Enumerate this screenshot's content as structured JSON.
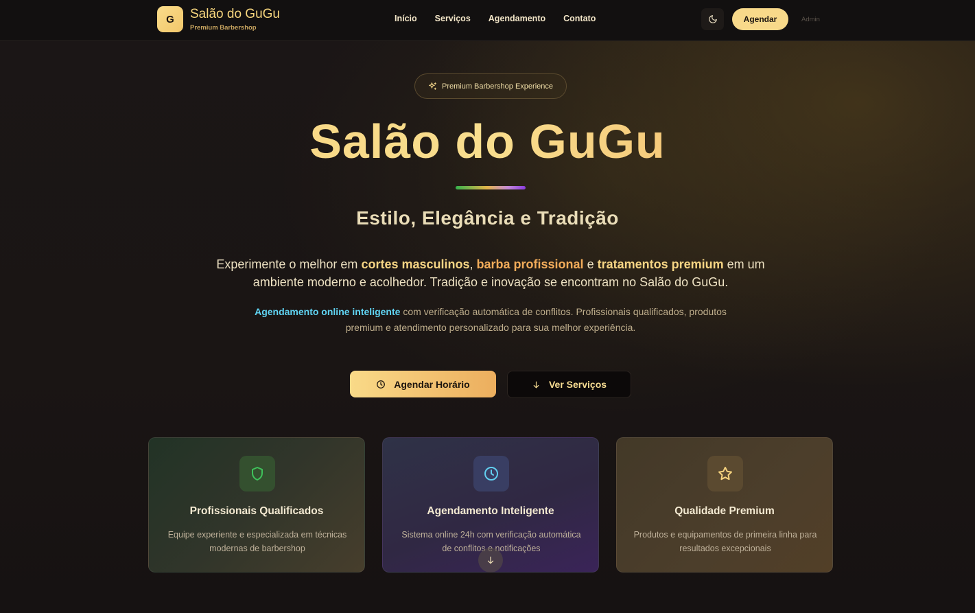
{
  "header": {
    "logo_letter": "G",
    "brand_title": "Salão do GuGu",
    "brand_subtitle": "Premium Barbershop",
    "nav": [
      "Início",
      "Serviços",
      "Agendamento",
      "Contato"
    ],
    "theme_icon": "moon-icon",
    "cta_label": "Agendar",
    "admin_label": "Admin"
  },
  "hero": {
    "badge": "Premium Barbershop Experience",
    "title": "Salão do GuGu",
    "subtitle": "Estilo, Elegância e Tradição",
    "desc_1": "Experimente o melhor em ",
    "desc_hl_1": "cortes masculinos",
    "desc_2": ", ",
    "desc_hl_2": "barba profissional",
    "desc_3": " e ",
    "desc_hl_3": "tratamentos premium",
    "desc_4": " em um ambiente moderno e acolhedor. Tradição e inovação se encontram no Salão do GuGu.",
    "note_hl": "Agendamento online inteligente",
    "note_rest": " com verificação automática de conflitos. Profissionais qualificados, produtos premium e atendimento personalizado para sua melhor experiência.",
    "primary_button": "Agendar Horário",
    "secondary_button": "Ver Serviços"
  },
  "features": [
    {
      "icon": "shield-icon",
      "title": "Profissionais Qualificados",
      "text": "Equipe experiente e especializada em técnicas modernas de barbershop"
    },
    {
      "icon": "clock-icon",
      "title": "Agendamento Inteligente",
      "text": "Sistema online 24h com verificação automática de conflitos e notificações"
    },
    {
      "icon": "star-icon",
      "title": "Qualidade Premium",
      "text": "Produtos e equipamentos de primeira linha para resultados excepcionais"
    }
  ],
  "colors": {
    "accent_gold": "#f8d98a",
    "accent_orange": "#f2ac5a",
    "accent_cyan": "#60d4f3",
    "background": "#1a1514"
  }
}
